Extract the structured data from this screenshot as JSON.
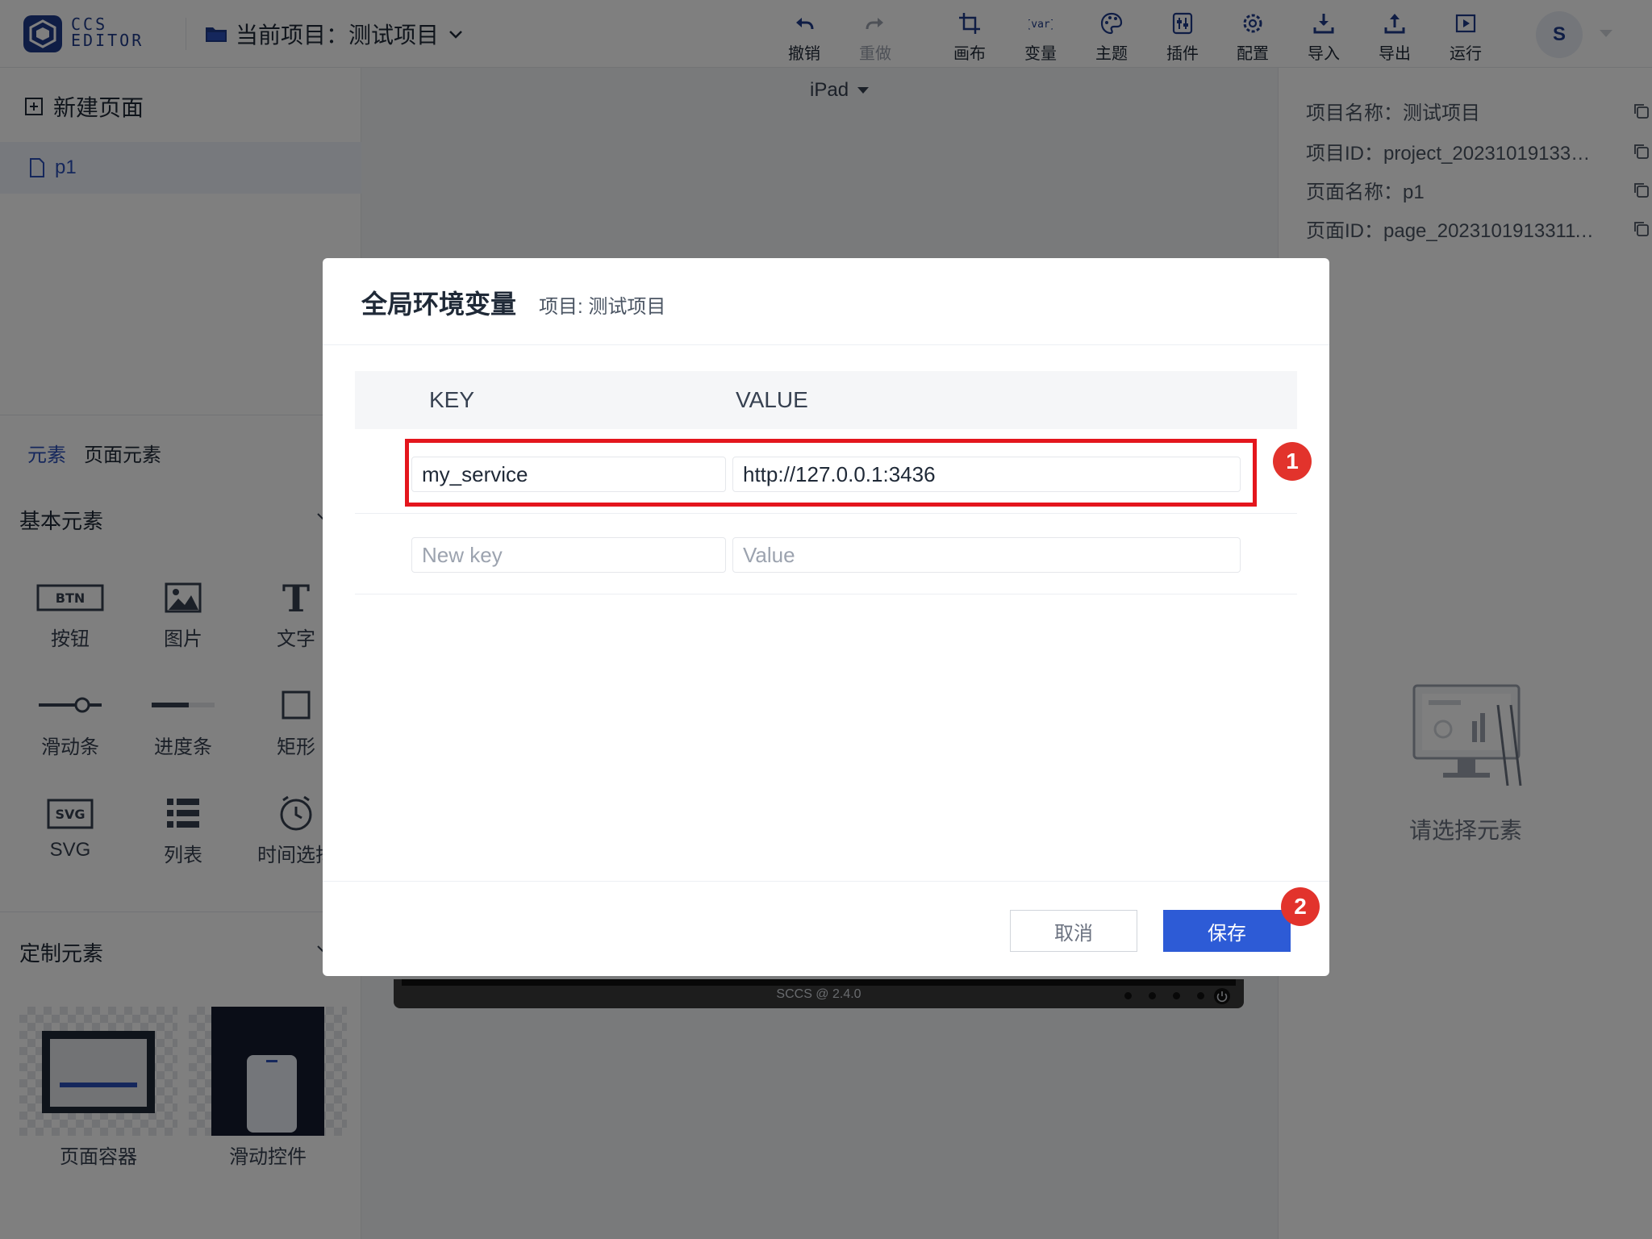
{
  "app": {
    "logo_line1": "CCS",
    "logo_line2": "EDITOR",
    "project_label": "当前项目：测试项目"
  },
  "toolbar": {
    "undo": "撤销",
    "redo": "重做",
    "canvas": "画布",
    "variables": "变量",
    "theme": "主题",
    "plugins": "插件",
    "config": "配置",
    "import": "导入",
    "export": "导出",
    "run": "运行"
  },
  "user": {
    "avatar_letter": "S"
  },
  "left_panel": {
    "new_page": "新建页面",
    "pages": [
      "p1"
    ],
    "tabs": [
      "元素",
      "页面元素"
    ],
    "basic_section": "基本元素",
    "basic_elements": [
      "按钮",
      "图片",
      "文字",
      "滑动条",
      "进度条",
      "矩形",
      "SVG",
      "列表",
      "时间选择"
    ],
    "custom_section": "定制元素",
    "custom_elements": [
      "页面容器",
      "滑动控件"
    ]
  },
  "canvas": {
    "device": "iPad",
    "footer_brand": "SCCS @ 2.4.0"
  },
  "right_panel": {
    "project_name": "项目名称：测试项目",
    "project_id": "项目ID：project_202310191331...",
    "page_name": "页面名称：p1",
    "page_id": "页面ID：page_20231019133111...",
    "empty_hint": "请选择元素"
  },
  "modal": {
    "title": "全局环境变量",
    "subtitle": "项目: 测试项目",
    "col_key": "KEY",
    "col_value": "VALUE",
    "rows": [
      {
        "key": "my_service",
        "value": "http://127.0.0.1:3436"
      }
    ],
    "new_key_placeholder": "New key",
    "new_value_placeholder": "Value",
    "cancel": "取消",
    "save": "保存"
  },
  "annotations": {
    "step1": "1",
    "step2": "2",
    "highlight_color": "#e4161d"
  },
  "colors": {
    "brand": "#1e3a8a",
    "primary": "#2d5bd6",
    "badge": "#e2332c"
  }
}
